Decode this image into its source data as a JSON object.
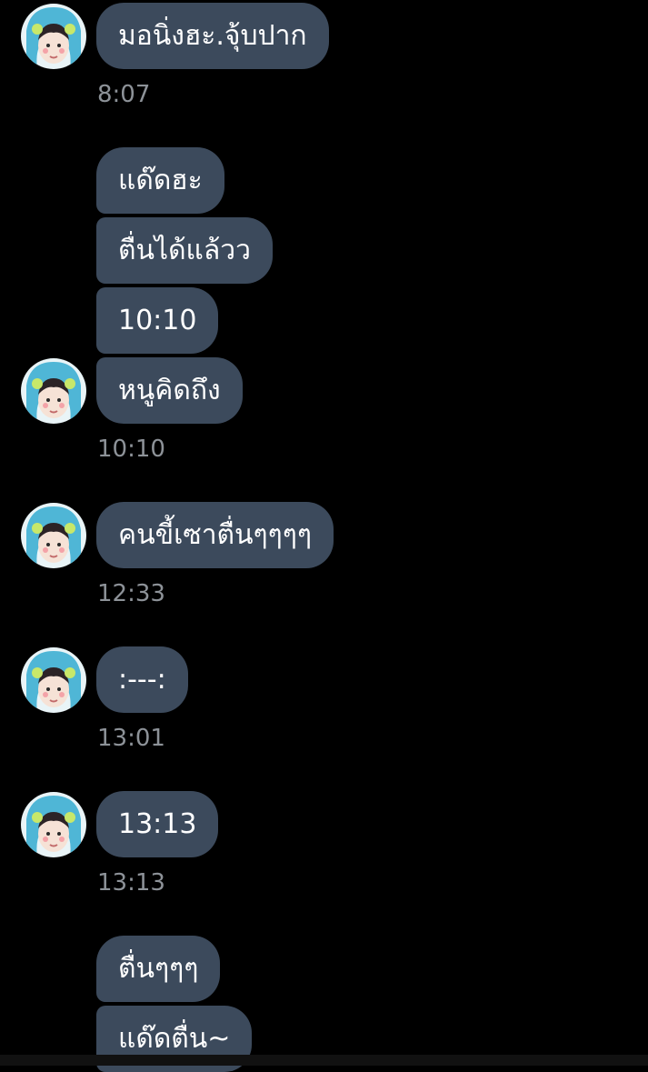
{
  "messages": [
    {
      "text": "มอนิ่งฮะ.จุ้บปาก"
    },
    {
      "time": "8:07"
    },
    {
      "text": "แด๊ดฮะ"
    },
    {
      "text": "ตื่นได้แล้วว"
    },
    {
      "text": "10:10"
    },
    {
      "text": "หนูคิดถึง"
    },
    {
      "time": "10:10"
    },
    {
      "text": "คนขี้เซาตื่นๆๆๆๆ"
    },
    {
      "time": "12:33"
    },
    {
      "text": ":---:"
    },
    {
      "time": "13:01"
    },
    {
      "text": "13:13"
    },
    {
      "time": "13:13"
    },
    {
      "text": "ตื่นๆๆๆ"
    },
    {
      "text": "แด๊ดตื่น~"
    }
  ],
  "colors": {
    "background": "#000000",
    "bubble": "#3c4a5c",
    "bubble_text": "#ffffff",
    "timestamp": "#8d9298"
  },
  "icons": {
    "avatar": "user-avatar-photo"
  }
}
